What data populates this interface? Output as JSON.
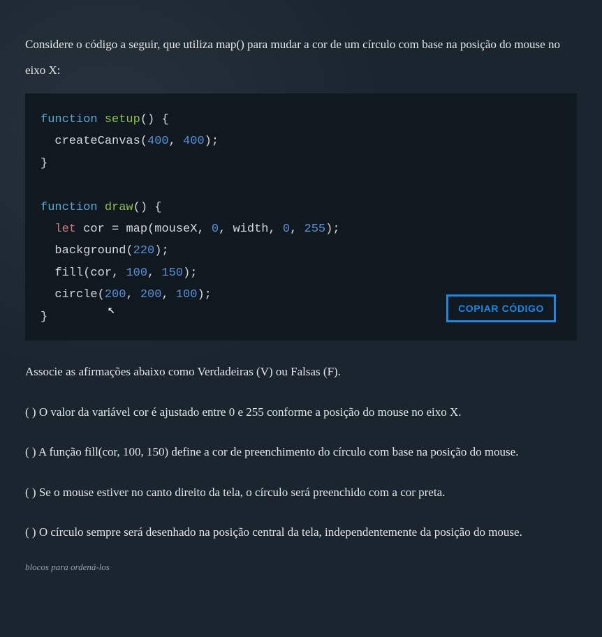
{
  "intro": "Considere o código a seguir, que utiliza map() para mudar a cor de um círculo com base na posição do mouse no eixo X:",
  "code": {
    "lines": [
      {
        "type": "fn_sig",
        "kw": "function",
        "name": "setup",
        "after": "() {"
      },
      {
        "type": "call1",
        "indent": "  ",
        "fn": "createCanvas",
        "open": "(",
        "n1": "400",
        "sep": ", ",
        "n2": "400",
        "close": ");"
      },
      {
        "type": "brace",
        "text": "}"
      },
      {
        "type": "blank",
        "text": ""
      },
      {
        "type": "fn_sig",
        "kw": "function",
        "name": "draw",
        "after": "() {"
      },
      {
        "type": "let_map",
        "indent": "  ",
        "kw": "let",
        "var": " cor = ",
        "fn": "map",
        "open": "(",
        "arg1": "mouseX, ",
        "n1": "0",
        "sep1": ", ",
        "arg2": "width, ",
        "n2": "0",
        "sep2": ", ",
        "n3": "255",
        "close": ");"
      },
      {
        "type": "call_single",
        "indent": "  ",
        "fn": "background",
        "open": "(",
        "n1": "220",
        "close": ");"
      },
      {
        "type": "fill",
        "indent": "  ",
        "fn": "fill",
        "open": "(",
        "arg1": "cor, ",
        "n1": "100",
        "sep": ", ",
        "n2": "150",
        "close": ");"
      },
      {
        "type": "call3",
        "indent": "  ",
        "fn": "circle",
        "open": "(",
        "n1": "200",
        "sep1": ", ",
        "n2": "200",
        "sep2": ", ",
        "n3": "100",
        "close": ");"
      },
      {
        "type": "brace",
        "text": "}"
      }
    ],
    "copy_label": "COPIAR CÓDIGO"
  },
  "question_intro": "Associe as afirmações abaixo como Verdadeiras (V) ou Falsas (F).",
  "statements": [
    "( ) O valor da variável cor é ajustado entre 0 e 255 conforme a posição do mouse no eixo X.",
    "( ) A função fill(cor, 100, 150) define a cor de preenchimento do círculo com base na posição do mouse.",
    "( ) Se o mouse estiver no canto direito da tela, o círculo será preenchido com a cor preta.",
    "( ) O círculo sempre será desenhado na posição central da tela, independentemente da posição do mouse."
  ],
  "footer_fragment": "blocos para ordená-los"
}
